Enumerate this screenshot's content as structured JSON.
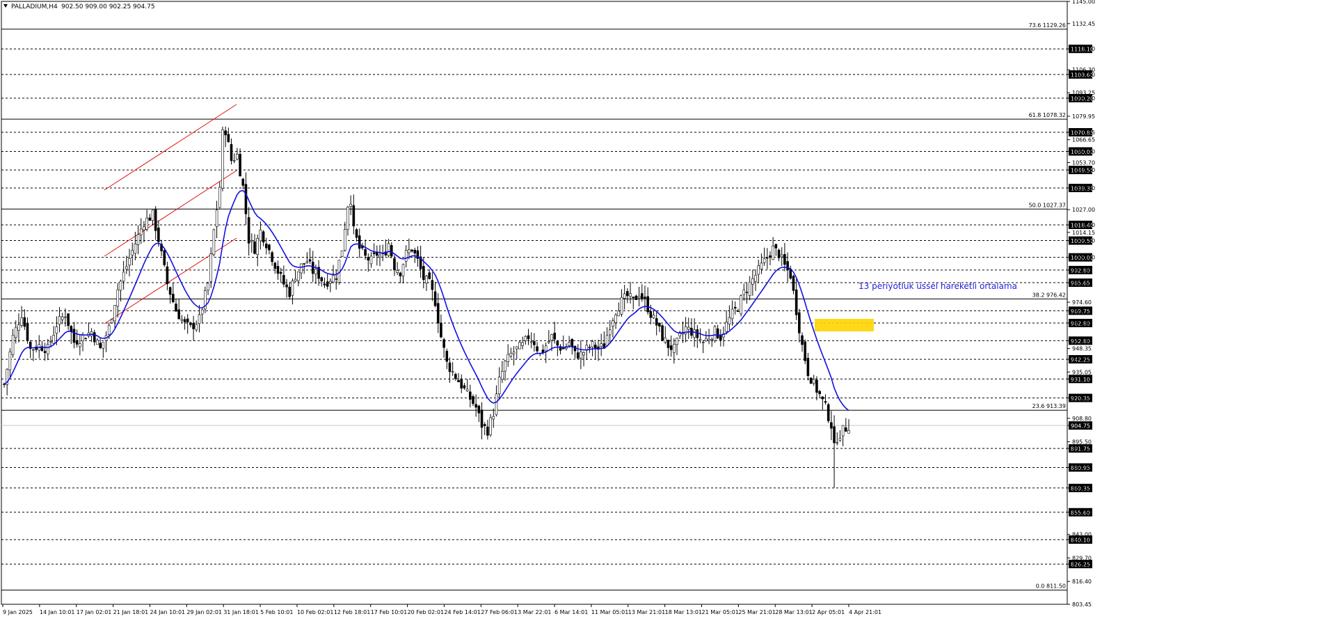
{
  "header": {
    "symbol_label": "PALLADIUM,H4",
    "ohlc_label": "902.50 909.00 902.25 904.75"
  },
  "annotation": {
    "text": "13 periyotluk üssel hareketli ortalama",
    "color": "#1f1fdd"
  },
  "colors": {
    "candle": "#000000",
    "ema": "#1010e0",
    "channel": "#e01010",
    "fib": "#000000",
    "level": "#000000",
    "highlight": "#ffd400",
    "current": "#c8c8c8"
  },
  "chart_data": {
    "type": "candlestick",
    "instrument": "PALLADIUM",
    "timeframe": "H4",
    "ylim": [
      803.45,
      1145.0
    ],
    "price_ticks": [
      "1145.00",
      "1132.45",
      "1118.10",
      "1106.30",
      "1103.60",
      "1093.25",
      "1090.20",
      "1079.95",
      "1070.85",
      "1066.65",
      "1060.00",
      "1053.70",
      "1049.50",
      "1039.30",
      "1027.00",
      "1018.40",
      "1014.15",
      "1009.50",
      "1000.00",
      "992.80",
      "985.65",
      "974.60",
      "969.75",
      "962.80",
      "952.80",
      "948.35",
      "942.25",
      "935.05",
      "931.10",
      "920.35",
      "908.80",
      "904.75",
      "895.50",
      "891.75",
      "880.95",
      "869.35",
      "855.60",
      "843.00",
      "840.10",
      "829.70",
      "826.25",
      "816.40",
      "803.45"
    ],
    "time_labels": [
      "9 Jan 2025",
      "14 Jan 10:01",
      "17 Jan 02:01",
      "21 Jan 18:01",
      "24 Jan 10:01",
      "29 Jan 02:01",
      "31 Jan 18:01",
      "5 Feb 10:01",
      "10 Feb 02:01",
      "12 Feb 18:01",
      "17 Feb 10:01",
      "20 Feb 02:01",
      "24 Feb 14:01",
      "27 Feb 06:01",
      "3 Mar 22:01",
      "6 Mar 14:01",
      "11 Mar 05:01",
      "13 Mar 21:01",
      "18 Mar 13:01",
      "21 Mar 05:01",
      "25 Mar 21:01",
      "28 Mar 13:01",
      "2 Apr 05:01",
      "4 Apr 21:01"
    ],
    "fibonacci": [
      {
        "label": "73.6",
        "value": 1129.26
      },
      {
        "label": "61.8",
        "value": 1078.32
      },
      {
        "label": "50.0",
        "value": 1027.37
      },
      {
        "label": "38.2",
        "value": 976.42
      },
      {
        "label": "23.6",
        "value": 913.39
      },
      {
        "label": "0.0",
        "value": 811.5
      }
    ],
    "levels": [
      1118.1,
      1103.6,
      1090.2,
      1070.85,
      1060.0,
      1049.5,
      1039.3,
      1018.4,
      1009.5,
      1000.0,
      992.8,
      985.65,
      969.75,
      962.8,
      952.8,
      942.25,
      931.1,
      920.35,
      891.75,
      880.95,
      869.35,
      855.6,
      840.1,
      826.25
    ],
    "current_price": 904.75,
    "ema_period": 13,
    "price_path": [
      [
        0,
        928
      ],
      [
        3,
        955
      ],
      [
        6,
        968
      ],
      [
        9,
        948
      ],
      [
        12,
        950
      ],
      [
        15,
        948
      ],
      [
        18,
        962
      ],
      [
        21,
        968
      ],
      [
        24,
        952
      ],
      [
        27,
        955
      ],
      [
        30,
        958
      ],
      [
        33,
        948
      ],
      [
        36,
        960
      ],
      [
        39,
        982
      ],
      [
        42,
        995
      ],
      [
        45,
        1008
      ],
      [
        48,
        1020
      ],
      [
        51,
        1024
      ],
      [
        53,
        1010
      ],
      [
        56,
        985
      ],
      [
        59,
        970
      ],
      [
        62,
        962
      ],
      [
        64,
        960
      ],
      [
        67,
        965
      ],
      [
        70,
        985
      ],
      [
        72,
        1015
      ],
      [
        74,
        1040
      ],
      [
        75,
        1070
      ],
      [
        76,
        1072
      ],
      [
        78,
        1055
      ],
      [
        80,
        1058
      ],
      [
        82,
        1040
      ],
      [
        84,
        1010
      ],
      [
        86,
        1005
      ],
      [
        88,
        1015
      ],
      [
        90,
        1008
      ],
      [
        92,
        1000
      ],
      [
        94,
        992
      ],
      [
        96,
        985
      ],
      [
        98,
        980
      ],
      [
        100,
        990
      ],
      [
        102,
        995
      ],
      [
        104,
        998
      ],
      [
        106,
        992
      ],
      [
        108,
        990
      ],
      [
        110,
        985
      ],
      [
        112,
        988
      ],
      [
        114,
        990
      ],
      [
        116,
        1005
      ],
      [
        118,
        1030
      ],
      [
        119,
        1033
      ],
      [
        120,
        1015
      ],
      [
        122,
        1005
      ],
      [
        124,
        1000
      ],
      [
        126,
        998
      ],
      [
        128,
        1002
      ],
      [
        130,
        1000
      ],
      [
        132,
        1008
      ],
      [
        134,
        995
      ],
      [
        136,
        992
      ],
      [
        138,
        1002
      ],
      [
        140,
        1005
      ],
      [
        142,
        998
      ],
      [
        144,
        988
      ],
      [
        146,
        985
      ],
      [
        148,
        975
      ],
      [
        150,
        955
      ],
      [
        152,
        940
      ],
      [
        154,
        935
      ],
      [
        156,
        930
      ],
      [
        158,
        925
      ],
      [
        160,
        920
      ],
      [
        162,
        915
      ],
      [
        164,
        905
      ],
      [
        166,
        902
      ],
      [
        168,
        912
      ],
      [
        170,
        930
      ],
      [
        172,
        940
      ],
      [
        174,
        945
      ],
      [
        176,
        948
      ],
      [
        178,
        950
      ],
      [
        180,
        955
      ],
      [
        182,
        952
      ],
      [
        184,
        945
      ],
      [
        186,
        950
      ],
      [
        188,
        955
      ],
      [
        190,
        950
      ],
      [
        192,
        948
      ],
      [
        194,
        952
      ],
      [
        196,
        945
      ],
      [
        198,
        945
      ],
      [
        200,
        948
      ],
      [
        202,
        950
      ],
      [
        204,
        948
      ],
      [
        206,
        950
      ],
      [
        208,
        962
      ],
      [
        210,
        970
      ],
      [
        212,
        975
      ],
      [
        214,
        978
      ],
      [
        216,
        975
      ],
      [
        218,
        980
      ],
      [
        220,
        975
      ],
      [
        222,
        968
      ],
      [
        224,
        962
      ],
      [
        226,
        955
      ],
      [
        228,
        950
      ],
      [
        230,
        948
      ],
      [
        232,
        955
      ],
      [
        234,
        960
      ],
      [
        236,
        958
      ],
      [
        238,
        955
      ],
      [
        240,
        952
      ],
      [
        242,
        955
      ],
      [
        244,
        958
      ],
      [
        246,
        955
      ],
      [
        248,
        962
      ],
      [
        250,
        968
      ],
      [
        252,
        972
      ],
      [
        254,
        980
      ],
      [
        256,
        985
      ],
      [
        258,
        990
      ],
      [
        260,
        995
      ],
      [
        262,
        1000
      ],
      [
        264,
        1005
      ],
      [
        266,
        1002
      ],
      [
        268,
        995
      ],
      [
        270,
        990
      ],
      [
        272,
        970
      ],
      [
        274,
        950
      ],
      [
        276,
        935
      ],
      [
        278,
        928
      ],
      [
        280,
        922
      ],
      [
        282,
        915
      ],
      [
        284,
        905
      ],
      [
        285,
        892
      ],
      [
        286,
        898
      ],
      [
        288,
        902
      ],
      [
        290,
        904.75
      ]
    ]
  }
}
